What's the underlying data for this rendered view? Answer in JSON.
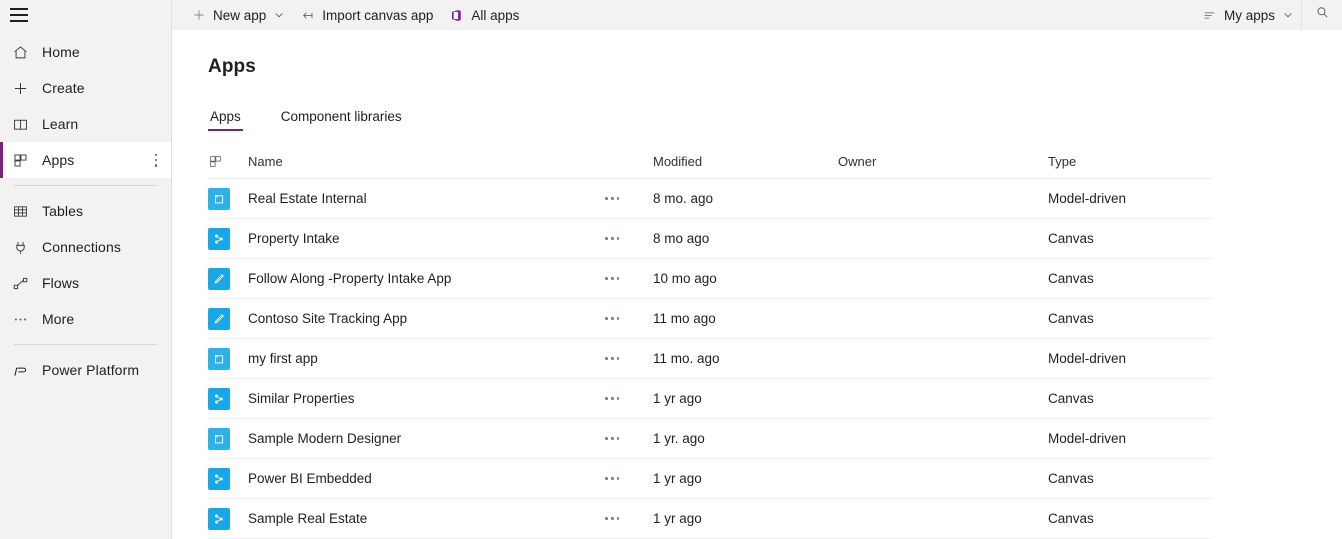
{
  "sidebar": {
    "hamburger": "hamburger-menu",
    "items": [
      {
        "label": "Home",
        "icon": "home-icon",
        "selected": false
      },
      {
        "label": "Create",
        "icon": "plus-icon",
        "selected": false
      },
      {
        "label": "Learn",
        "icon": "book-icon",
        "selected": false
      },
      {
        "label": "Apps",
        "icon": "apps-grid-icon",
        "selected": true
      },
      {
        "label": "Tables",
        "icon": "table-icon",
        "selected": false
      },
      {
        "label": "Connections",
        "icon": "connection-plug-icon",
        "selected": false
      },
      {
        "label": "Flows",
        "icon": "flow-icon",
        "selected": false
      },
      {
        "label": "More",
        "icon": "more-ellipsis-icon",
        "selected": false
      },
      {
        "label": "Power Platform",
        "icon": "power-platform-icon",
        "selected": false
      }
    ]
  },
  "command_bar": {
    "new_app": "New app",
    "import_canvas_app": "Import canvas app",
    "all_apps": "All apps",
    "my_apps": "My apps",
    "search_label": "Search"
  },
  "page": {
    "title": "Apps",
    "tabs": [
      {
        "label": "Apps",
        "active": true
      },
      {
        "label": "Component libraries",
        "active": false
      }
    ]
  },
  "table": {
    "columns": {
      "icon": "",
      "name": "Name",
      "modified": "Modified",
      "owner": "Owner",
      "type": "Type"
    },
    "rows": [
      {
        "name": "Real Estate Internal",
        "modified": "8 mo. ago",
        "owner": "",
        "type": "Model-driven",
        "icon": "model-driven-app-icon"
      },
      {
        "name": "Property Intake",
        "modified": "8 mo ago",
        "owner": "",
        "type": "Canvas",
        "icon": "canvas-app-icon"
      },
      {
        "name": "Follow Along -Property Intake App",
        "modified": "10 mo ago",
        "owner": "",
        "type": "Canvas",
        "icon": "pencil-app-icon"
      },
      {
        "name": "Contoso Site Tracking App",
        "modified": "11 mo ago",
        "owner": "",
        "type": "Canvas",
        "icon": "pencil-app-icon"
      },
      {
        "name": "my first app",
        "modified": "11 mo. ago",
        "owner": "",
        "type": "Model-driven",
        "icon": "model-driven-app-icon"
      },
      {
        "name": "Similar Properties",
        "modified": "1 yr ago",
        "owner": "",
        "type": "Canvas",
        "icon": "canvas-app-icon"
      },
      {
        "name": "Sample Modern Designer",
        "modified": "1 yr. ago",
        "owner": "",
        "type": "Model-driven",
        "icon": "model-driven-app-icon"
      },
      {
        "name": "Power BI Embedded",
        "modified": "1 yr ago",
        "owner": "",
        "type": "Canvas",
        "icon": "canvas-app-icon"
      },
      {
        "name": "Sample Real Estate",
        "modified": "1 yr ago",
        "owner": "",
        "type": "Canvas",
        "icon": "canvas-app-icon"
      }
    ]
  },
  "colors": {
    "accent_purple": "#742774",
    "app_tile_blue": "#2eb0e8",
    "chrome_gray": "#f3f2f1"
  }
}
